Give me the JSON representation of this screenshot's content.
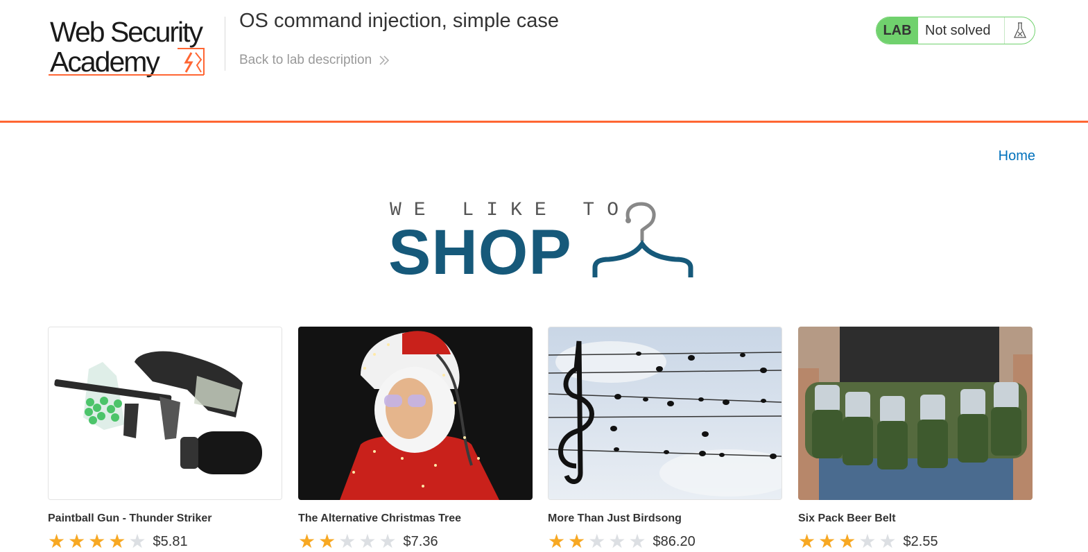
{
  "header": {
    "logo": {
      "line1": "Web Security",
      "line2": "Academy"
    },
    "lab_title": "OS command injection, simple case",
    "back_link": "Back to lab description",
    "status": {
      "badge": "LAB",
      "text": "Not solved",
      "icon": "flask-icon"
    }
  },
  "colors": {
    "accent": "#ff6633",
    "brand_blue": "#16597a",
    "link_blue": "#0071bc",
    "solved_green": "#70d16d",
    "star": "#f7a823"
  },
  "nav": {
    "home": "Home"
  },
  "banner": {
    "top_text": "WE LIKE TO",
    "main_text": "SHOP",
    "icon": "hanger-icon"
  },
  "products": [
    {
      "name": "Paintball Gun - Thunder Striker",
      "rating": 4,
      "price": "$5.81"
    },
    {
      "name": "The Alternative Christmas Tree",
      "rating": 2,
      "price": "$7.36"
    },
    {
      "name": "More Than Just Birdsong",
      "rating": 2,
      "price": "$86.20"
    },
    {
      "name": "Six Pack Beer Belt",
      "rating": 3,
      "price": "$2.55"
    }
  ]
}
